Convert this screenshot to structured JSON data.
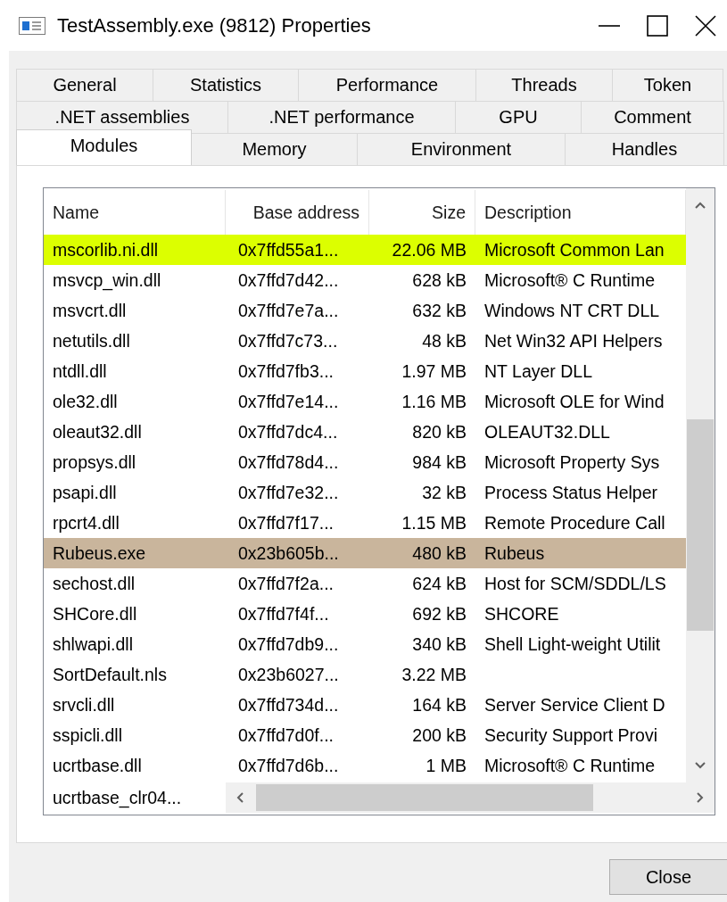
{
  "window": {
    "title": "TestAssembly.exe (9812) Properties"
  },
  "tab_rows": [
    [
      {
        "label": "General",
        "selected": false
      },
      {
        "label": "Statistics",
        "selected": false
      },
      {
        "label": "Performance",
        "selected": false
      },
      {
        "label": "Threads",
        "selected": false
      },
      {
        "label": "Token",
        "selected": false
      }
    ],
    [
      {
        "label": ".NET assemblies",
        "selected": false
      },
      {
        "label": ".NET performance",
        "selected": false
      },
      {
        "label": "GPU",
        "selected": false
      },
      {
        "label": "Comment",
        "selected": false
      }
    ],
    [
      {
        "label": "Modules",
        "selected": true
      },
      {
        "label": "Memory",
        "selected": false
      },
      {
        "label": "Environment",
        "selected": false
      },
      {
        "label": "Handles",
        "selected": false
      }
    ]
  ],
  "table": {
    "columns": [
      "Name",
      "Base address",
      "Size",
      "Description"
    ],
    "rows": [
      {
        "name": "mscorlib.ni.dll",
        "base_address": "0x7ffd55a1...",
        "size": "22.06 MB",
        "description": "Microsoft Common Lan",
        "color": "#dcff00"
      },
      {
        "name": "msvcp_win.dll",
        "base_address": "0x7ffd7d42...",
        "size": "628 kB",
        "description": "Microsoft® C Runtime"
      },
      {
        "name": "msvcrt.dll",
        "base_address": "0x7ffd7e7a...",
        "size": "632 kB",
        "description": "Windows NT CRT DLL"
      },
      {
        "name": "netutils.dll",
        "base_address": "0x7ffd7c73...",
        "size": "48 kB",
        "description": "Net Win32 API Helpers"
      },
      {
        "name": "ntdll.dll",
        "base_address": "0x7ffd7fb3...",
        "size": "1.97 MB",
        "description": "NT Layer DLL"
      },
      {
        "name": "ole32.dll",
        "base_address": "0x7ffd7e14...",
        "size": "1.16 MB",
        "description": "Microsoft OLE for Wind"
      },
      {
        "name": "oleaut32.dll",
        "base_address": "0x7ffd7dc4...",
        "size": "820 kB",
        "description": "OLEAUT32.DLL"
      },
      {
        "name": "propsys.dll",
        "base_address": "0x7ffd78d4...",
        "size": "984 kB",
        "description": "Microsoft Property Sys"
      },
      {
        "name": "psapi.dll",
        "base_address": "0x7ffd7e32...",
        "size": "32 kB",
        "description": "Process Status Helper"
      },
      {
        "name": "rpcrt4.dll",
        "base_address": "0x7ffd7f17...",
        "size": "1.15 MB",
        "description": "Remote Procedure Call"
      },
      {
        "name": "Rubeus.exe",
        "base_address": "0x23b605b...",
        "size": "480 kB",
        "description": "Rubeus",
        "color": "#c9b59c"
      },
      {
        "name": "sechost.dll",
        "base_address": "0x7ffd7f2a...",
        "size": "624 kB",
        "description": "Host for SCM/SDDL/LS"
      },
      {
        "name": "SHCore.dll",
        "base_address": "0x7ffd7f4f...",
        "size": "692 kB",
        "description": "SHCORE"
      },
      {
        "name": "shlwapi.dll",
        "base_address": "0x7ffd7db9...",
        "size": "340 kB",
        "description": "Shell Light-weight Utilit"
      },
      {
        "name": "SortDefault.nls",
        "base_address": "0x23b6027...",
        "size": "3.22 MB"
      },
      {
        "name": "srvcli.dll",
        "base_address": "0x7ffd734d...",
        "size": "164 kB",
        "description": "Server Service Client D"
      },
      {
        "name": "sspicli.dll",
        "base_address": "0x7ffd7d0f...",
        "size": "200 kB",
        "description": "Security Support Provi"
      },
      {
        "name": "ucrtbase.dll",
        "base_address": "0x7ffd7d6b...",
        "size": "1 MB",
        "description": "Microsoft® C Runtime"
      }
    ],
    "partial_row": {
      "name": "ucrtbase_clr04..."
    }
  },
  "buttons": [
    "Close"
  ]
}
